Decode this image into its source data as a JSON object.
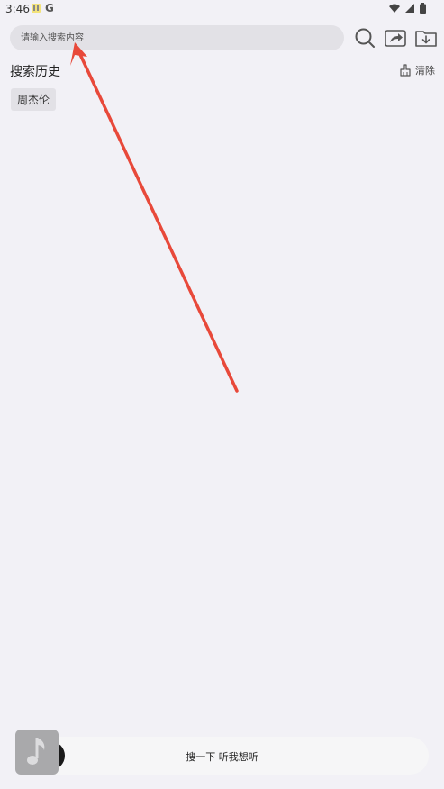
{
  "status_bar": {
    "time": "3:46"
  },
  "search": {
    "placeholder": "请输入搜索内容",
    "value": ""
  },
  "history": {
    "title": "搜索历史",
    "clear_label": "清除",
    "items": [
      "周杰伦"
    ]
  },
  "player": {
    "text": "搜一下 听我想听"
  },
  "colors": {
    "annotation": "#e8493a",
    "background": "#f2f1f6"
  },
  "icons": [
    "search-icon",
    "share-icon",
    "download-folder-icon",
    "broom-icon",
    "music-note-icon"
  ]
}
